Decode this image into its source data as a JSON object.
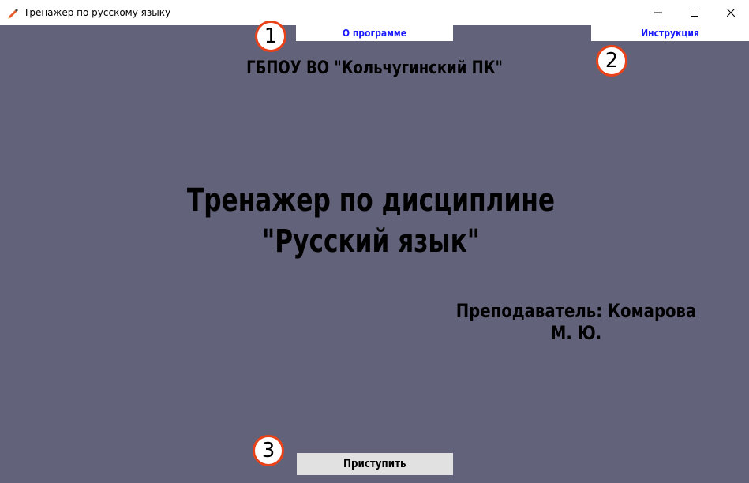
{
  "window": {
    "title": "Тренажер по русскому языку"
  },
  "nav": {
    "about_label": "О программе",
    "instructions_label": "Инструкция"
  },
  "content": {
    "college": "ГБПОУ ВО \"Кольчугинский ПК\"",
    "title_line1": "Тренажер по дисциплине",
    "title_line2": "\"Русский язык\"",
    "teacher": "Преподаватель: Комарова М. Ю."
  },
  "actions": {
    "start_label": "Приступить"
  },
  "callouts": [
    "1",
    "2",
    "3"
  ],
  "colors": {
    "background": "#62627a",
    "link_text": "#1a1aff",
    "callout_border": "#e8421a"
  }
}
